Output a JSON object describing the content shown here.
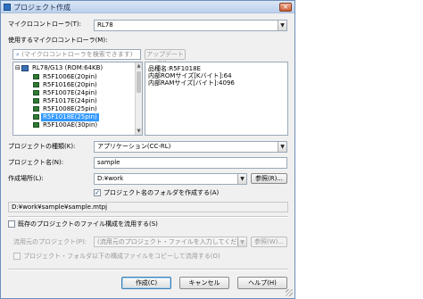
{
  "window": {
    "title": "プロジェクト作成",
    "close_glyph": "×"
  },
  "mcu": {
    "label": "マイクロコントローラ(T):",
    "value": "RL78"
  },
  "used_mcu": {
    "label": "使用するマイクロコントローラ(M):",
    "search_placeholder": "(マイクロコントローラを検索できます)",
    "update_button": "アップデート(U)...",
    "tree": [
      {
        "text": "RL78/G13 (ROM:64KB)",
        "level": 0,
        "expander": "⊟"
      },
      {
        "text": "R5F1006E(20pin)",
        "level": 1
      },
      {
        "text": "R5F1016E(20pin)",
        "level": 1
      },
      {
        "text": "R5F1007E(24pin)",
        "level": 1
      },
      {
        "text": "R5F1017E(24pin)",
        "level": 1
      },
      {
        "text": "R5F1008E(25pin)",
        "level": 1
      },
      {
        "text": "R5F1018E(25pin)",
        "level": 1,
        "selected": true
      },
      {
        "text": "R5F100AE(30pin)",
        "level": 1
      }
    ],
    "info": {
      "line1": "品種名:R5F1018E",
      "line2": "内部ROMサイズ[Kバイト]:64",
      "line3": "内部RAMサイズ[バイト]:4096"
    }
  },
  "project_type": {
    "label": "プロジェクトの種類(K):",
    "value": "アプリケーション(CC-RL)"
  },
  "project_name": {
    "label": "プロジェクト名(N):",
    "value": "sample"
  },
  "location": {
    "label": "作成場所(L):",
    "value": "D:¥work",
    "browse_button": "参照(R)..."
  },
  "create_folder": {
    "label": "プロジェクト名のフォルダを作成する(A)",
    "checked": true
  },
  "project_path": "D:¥work¥sample¥sample.mtpj",
  "reuse": {
    "label": "既存のプロジェクトのファイル構成を流用する(S)",
    "checked": false
  },
  "source_project": {
    "label": "流用元のプロジェクト(P):",
    "placeholder": "(流用元のプロジェクト・ファイルを入力してください)",
    "browse_button": "参照(W)..."
  },
  "copy_files": {
    "label": "プロジェクト・フォルダ以下の構成ファイルをコピーして流用する(O)",
    "checked": false
  },
  "buttons": {
    "create": "作成(C)",
    "cancel": "キャンセル",
    "help": "ヘルプ(H)"
  },
  "colors": {
    "selection": "#3399ff",
    "title_bar": "#bcd1ec",
    "dialog_bg": "#f0f0f0"
  }
}
